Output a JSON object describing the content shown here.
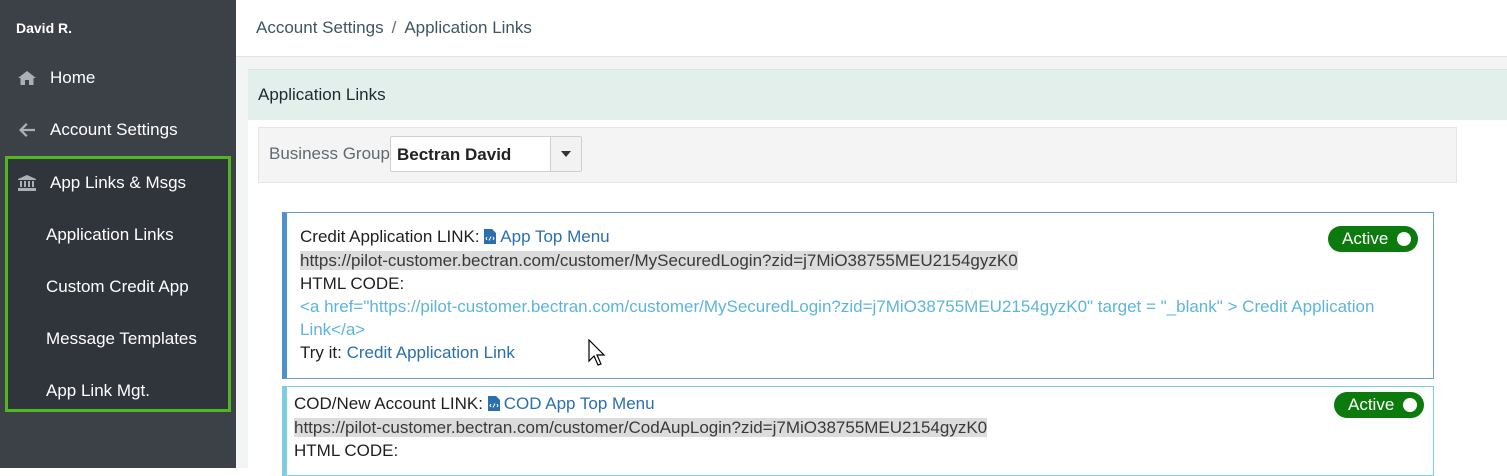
{
  "sidebar": {
    "user_name": "David R.",
    "items": [
      {
        "label": "Home",
        "icon": "home-icon"
      },
      {
        "label": "Account Settings",
        "icon": "arrow-left-icon"
      },
      {
        "label": "App Links & Msgs",
        "icon": "bank-icon"
      }
    ],
    "sub_items": [
      {
        "label": "Application Links"
      },
      {
        "label": "Custom Credit App"
      },
      {
        "label": "Message Templates"
      },
      {
        "label": "App Link Mgt."
      }
    ],
    "highlight_color": "#52b623"
  },
  "breadcrumb": {
    "parent": "Account Settings",
    "separator": "/",
    "current": "Application Links"
  },
  "panel": {
    "title": "Application Links",
    "business_group_label": "Business Group",
    "business_group_value": "Bectran David"
  },
  "links": [
    {
      "label": "Credit Application LINK:",
      "menu_link": "App Top Menu",
      "url": "https://pilot-customer.bectran.com/customer/MySecuredLogin?zid=j7MiO38755MEU2154gyzK0",
      "html_code_label": "HTML CODE:",
      "html_code_line1": "<a href=\"https://pilot-customer.bectran.com/customer/MySecuredLogin?zid=j7MiO38755MEU2154gyzK0\" target = \"_blank\" > Credit Application",
      "html_code_line2": "Link</a>",
      "try_label": "Try it:",
      "try_link": "Credit Application Link",
      "status": "Active"
    },
    {
      "label": "COD/New Account LINK:",
      "menu_link": "COD App Top Menu",
      "url": "https://pilot-customer.bectran.com/customer/CodAupLogin?zid=j7MiO38755MEU2154gyzK0",
      "html_code_label": "HTML CODE:",
      "status": "Active"
    }
  ],
  "colors": {
    "toggle_active": "#0c7a0c",
    "sidebar_bg": "#3c4148",
    "link_blue": "#2a6fae"
  }
}
